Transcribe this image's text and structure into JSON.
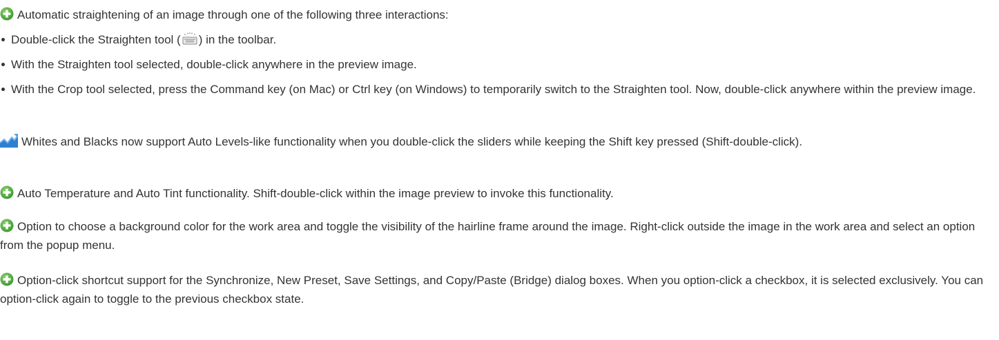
{
  "colors": {
    "text": "#333333",
    "new_feature_icon": "#4cb04a",
    "enhanced_icon": "#2f7fd0"
  },
  "intro": {
    "icon": "plus-circle-icon",
    "text": "Automatic straightening of an image through one of the following three interactions:"
  },
  "bullets": {
    "b1": {
      "before": "Double-click the Straighten tool (",
      "icon": "straighten-tool-icon",
      "after": ") in the toolbar."
    },
    "b2": {
      "text": "With the Straighten tool selected, double-click anywhere in the preview image."
    },
    "b3": {
      "text": "With the Crop tool selected, press the Command key (on Mac) or Ctrl key (on Windows) to temporarily switch to the Straighten tool. Now, double-click anywhere within the preview image."
    }
  },
  "features": {
    "whites_blacks": {
      "icon": "enhanced-chart-icon",
      "text": "Whites and Blacks now support Auto Levels-like functionality when you double-click the sliders while keeping the Shift key pressed (Shift-double-click)."
    },
    "auto_temp": {
      "icon": "plus-circle-icon",
      "text": "Auto Temperature and Auto Tint functionality. Shift-double-click within the image preview to invoke this functionality."
    },
    "background": {
      "icon": "plus-circle-icon",
      "text": "Option to choose a background color for the work area and toggle the visibility of the hairline frame around the image. Right-click outside the image in the work area and select an option from the popup menu."
    },
    "option_click": {
      "icon": "plus-circle-icon",
      "text": "Option-click shortcut support for the Synchronize, New Preset, Save Settings, and Copy/Paste (Bridge) dialog boxes. When you option-click a checkbox, it is selected exclusively. You can option-click again to toggle to the previous checkbox state."
    }
  }
}
